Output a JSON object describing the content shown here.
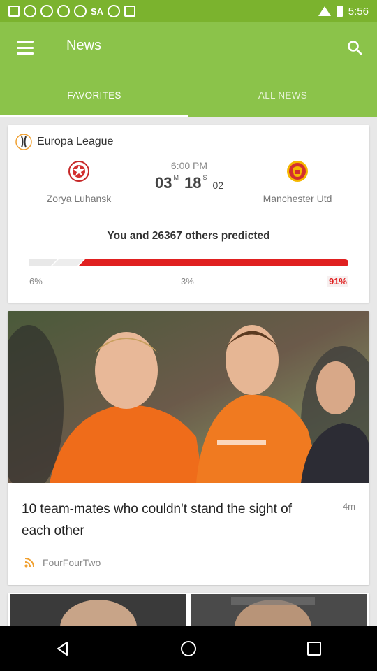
{
  "status_bar": {
    "carrier_text": "SA",
    "time": "5:56"
  },
  "app_bar": {
    "title": "News"
  },
  "tabs": [
    {
      "label": "FAVORITES",
      "active": true
    },
    {
      "label": "ALL NEWS",
      "active": false
    }
  ],
  "match": {
    "league": "Europa League",
    "home_team": "Zorya Luhansk",
    "away_team": "Manchester Utd",
    "kickoff_time": "6:00 PM",
    "countdown": {
      "hours": "03",
      "hours_unit": "M",
      "minutes": "18",
      "minutes_unit": "S",
      "seconds": "02"
    },
    "predicted_text": "You and 26367 others predicted",
    "prediction": {
      "home_pct": "6%",
      "draw_pct": "3%",
      "away_pct": "91%",
      "home": 6,
      "draw": 3,
      "away": 91
    }
  },
  "news": {
    "title": "10 team-mates who couldn't stand the sight of each other",
    "age": "4m",
    "source": "FourFourTwo"
  },
  "colors": {
    "app_bar": "#8bc34a",
    "status_bar": "#7bb32e",
    "prediction_red": "#e02020"
  }
}
